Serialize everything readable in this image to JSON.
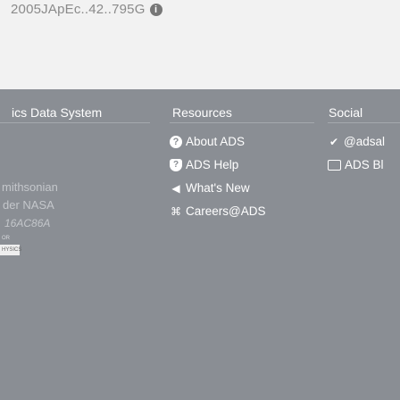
{
  "bibcode": "2005JApEc..42..795G",
  "footer": {
    "system_title": "ics Data System",
    "resources_title": "Resources",
    "social_title": "Social",
    "resources": [
      {
        "icon": "question-circle-icon",
        "glyph": "?",
        "label": "About ADS"
      },
      {
        "icon": "help-circle-icon",
        "glyph": "?",
        "label": "ADS Help"
      },
      {
        "icon": "bullhorn-icon",
        "glyph": "◀",
        "label": "What's New"
      },
      {
        "icon": "users-icon",
        "glyph": "⌘",
        "label": "Careers@ADS"
      }
    ],
    "social": [
      {
        "icon": "twitter-icon",
        "glyph": "✔",
        "label": "@adsal"
      },
      {
        "icon": "ads-blog-icon",
        "glyph": "▣",
        "label": "ADS Bl"
      }
    ],
    "faded_lines": [
      "mithsonian",
      "der NASA",
      "16AC86A"
    ],
    "logo_or": "OR",
    "logo_physics": "HYSICS"
  },
  "colors": {
    "top_bg": "#f2f2f2",
    "footer_bg": "#8a8e94",
    "text": "#ffffff"
  }
}
